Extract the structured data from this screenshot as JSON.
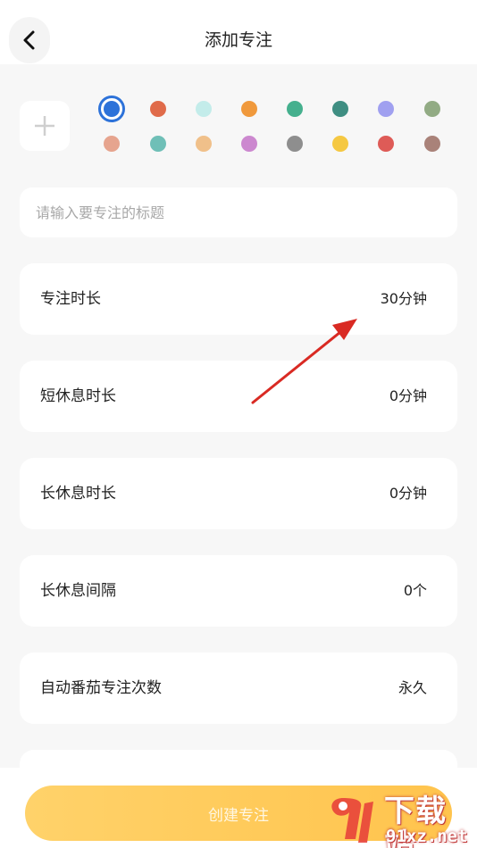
{
  "header": {
    "title": "添加专注",
    "back_icon": "chevron-left-icon"
  },
  "icon_picker": {
    "add_icon": "plus-icon"
  },
  "color_palette": {
    "selected": "#2d72d9",
    "colors": [
      "#2d72d9",
      "#e06b4a",
      "#c3ecea",
      "#f0993c",
      "#45b08e",
      "#3f8e82",
      "#a0a0f0",
      "#92ab84",
      "#e6a48e",
      "#6fbfb7",
      "#f0c08a",
      "#cc88cf",
      "#8e8e8e",
      "#f5c842",
      "#de5b57",
      "#a98279"
    ]
  },
  "title_input": {
    "placeholder": "请输入要专注的标题",
    "value": ""
  },
  "settings": [
    {
      "label": "专注时长",
      "value": "30分钟"
    },
    {
      "label": "短休息时长",
      "value": "0分钟"
    },
    {
      "label": "长休息时长",
      "value": "0分钟"
    },
    {
      "label": "长休息间隔",
      "value": "0个"
    },
    {
      "label": "自动番茄专注次数",
      "value": "永久"
    }
  ],
  "footer": {
    "create_label": "创建专注"
  },
  "watermark": {
    "title": "下载站",
    "domain": "91xz.net",
    "logo_text": "91"
  }
}
